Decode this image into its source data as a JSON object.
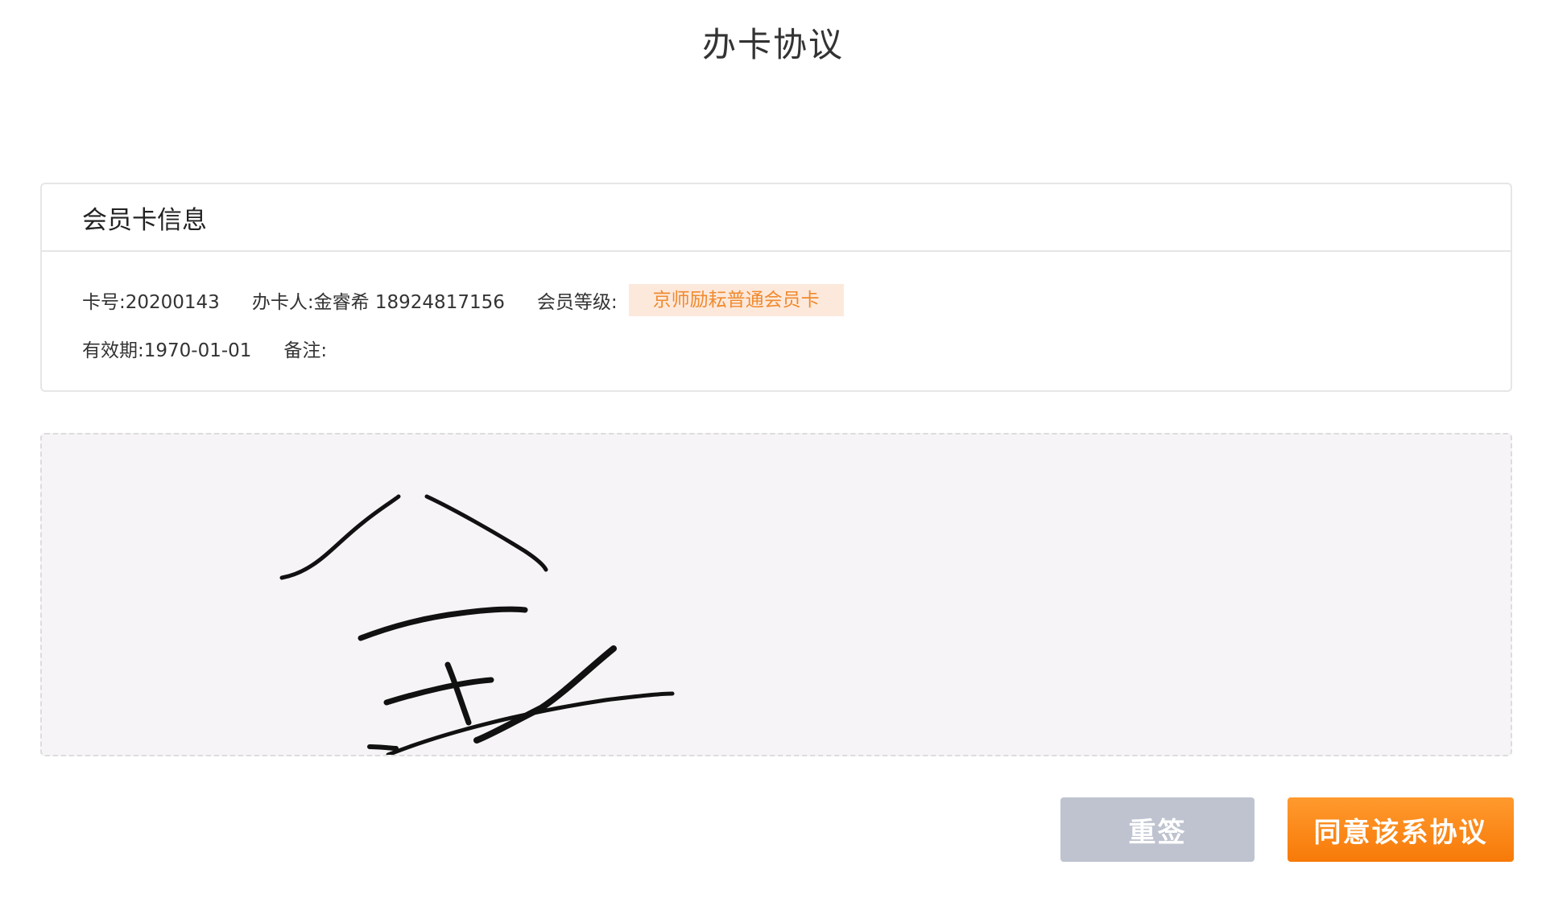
{
  "page": {
    "title": "办卡协议"
  },
  "card_info": {
    "title": "会员卡信息",
    "card_number": "卡号:20200143",
    "holder": "办卡人:金睿希 18924817156",
    "level_label": "会员等级:",
    "level_value": "京师励耘普通会员卡",
    "validity": "有效期:1970-01-01",
    "remark": "备注:"
  },
  "actions": {
    "resign_label": "重签",
    "agree_label": "同意该系协议"
  },
  "colors": {
    "accent_orange": "#f77a08",
    "badge_bg": "#fde9dc",
    "badge_text": "#f08a2e",
    "resign_button": "#bec3cf",
    "signature_bg": "#f7f4f7"
  }
}
